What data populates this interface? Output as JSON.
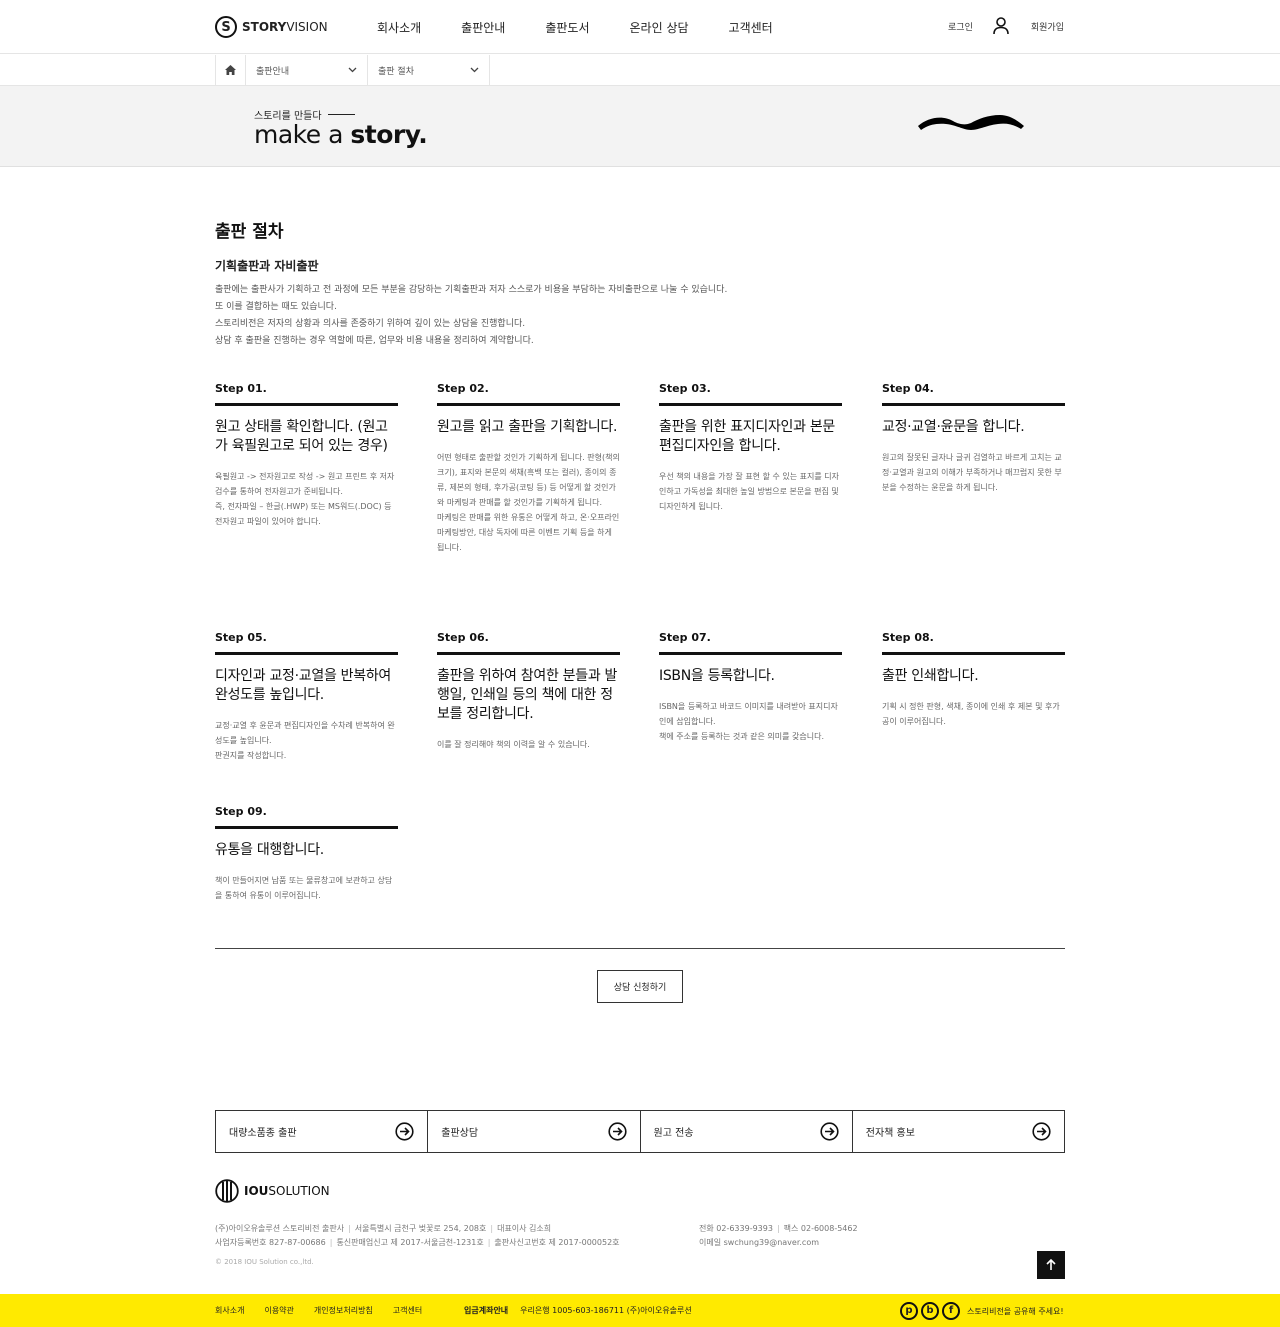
{
  "header": {
    "logo_mark": "S",
    "logo_bold": "STORY",
    "logo_light": "VISION",
    "nav": [
      "회사소개",
      "출판안내",
      "출판도서",
      "온라인 상담",
      "고객센터"
    ],
    "login": "로그인",
    "signup": "회원가입"
  },
  "breadcrumb": {
    "item1": "출판안내",
    "item2": "출판 절차"
  },
  "visual": {
    "subtitle": "스토리를 만들다",
    "title_light": "make a ",
    "title_bold": "story."
  },
  "content": {
    "page_title": "출판 절차",
    "section_title": "기획출판과 자비출판",
    "intro": [
      "출판에는 출판사가 기획하고 전 과정에 모든 부분을 감당하는 기획출판과 저자 스스로가 비용을 부담하는 자비출판으로 나눌 수 있습니다.",
      "또 이를 결합하는 때도 있습니다.",
      "스토리비전은 저자의 상황과 의사를 존중하기 위하여 깊이 있는 상담을 진행합니다.",
      "상담 후 출판을 진행하는 경우 역할에 따른, 업무와 비용 내용을 정리하여 계약합니다."
    ],
    "steps": [
      {
        "num": "Step 01.",
        "title": "원고 상태를 확인합니다. (원고가 육필원고로 되어 있는 경우)",
        "desc": "육필원고 -> 전자원고로 작성 -> 원고 프린트 후 저자 검수를 통하여 전자원고가 준비됩니다.\n즉, 전자파일 – 한글(.HWP) 또는 MS워드(.DOC) 등 전자원고 파일이 있어야 합니다."
      },
      {
        "num": "Step 02.",
        "title": "원고를 읽고 출판을 기획합니다.",
        "desc": "어떤 형태로 출판할 것인가 기획하게 됩니다. 판형(책의 크기), 표지와 본문의 색채(흑백 또는 컬러), 종이의 종류, 제본의 형태, 후가공(코팅 등) 등 어떻게 할 것인가와 마케팅과 판매를 할 것인가를 기획하게 됩니다.\n마케팅은 판매를 위한 유통은 어떻게 하고, 온·오프라인 마케팅방안, 대상 독자에 따른 이벤트 기획 등을 하게 됩니다."
      },
      {
        "num": "Step 03.",
        "title": "출판을 위한 표지디자인과 본문 편집디자인을 합니다.",
        "desc": "우선 책의 내용을 가장 잘 표현 할 수 있는 표지를 디자인하고 가독성을 최대한 높일 방법으로 본문을 편집 및 디자인하게 됩니다."
      },
      {
        "num": "Step 04.",
        "title": "교정·교열·윤문을 합니다.",
        "desc": "원고의 잘못된 글자나 글귀 검열하고 바르게 고치는 교정·교열과 원고의 이해가 부족하거나 매끄럽지 못한 부분을 수정하는 윤문을 하게 됩니다."
      },
      {
        "num": "Step 05.",
        "title": "디자인과 교정·교열을 반복하여 완성도를 높입니다.",
        "desc": "교정·교열 후 윤문과 편집디자인을 수차례 반복하여 완성도를 높입니다.\n판권지를 작성합니다."
      },
      {
        "num": "Step 06.",
        "title": "출판을 위하여 참여한 분들과 발행일, 인쇄일 등의 책에 대한 정보를 정리합니다.",
        "desc": "이를 잘 정리해야 책의 이력을 알 수 있습니다."
      },
      {
        "num": "Step 07.",
        "title": "ISBN을 등록합니다.",
        "desc": "ISBN을 등록하고 바코드 이미지를 내려받아 표지디자인에 삽입합니다.\n책에 주소를 등록하는 것과 같은 의미를 갖습니다."
      },
      {
        "num": "Step 08.",
        "title": "출판 인쇄합니다.",
        "desc": "기획 시 정한 판형, 색채, 종이에 인쇄 후 제본 및 후가공이 이루어집니다."
      },
      {
        "num": "Step 09.",
        "title": "유통을 대행합니다.",
        "desc": "책이 만들어지면 납품 또는 물류창고에 보관하고 상담을 통하여 유통이 이루어집니다."
      }
    ],
    "consult_button": "상담 신청하기"
  },
  "quick_links": [
    "대량소품종 출판",
    "출판상담",
    "원고 전송",
    "전자책 홍보"
  ],
  "footer": {
    "logo_bold": "IOU",
    "logo_light": "SOLUTION",
    "company": "(주)아이오유솔루션 스토리비전 출판사",
    "address": "서울특별시 금천구 벚꽃로 254, 208호",
    "ceo": "대표이사 김소희",
    "biz_no": "사업자등록번호 827-87-00686",
    "ecommerce_no": "통신판매업신고 제 2017-서울금천-1231호",
    "publisher_no": "출판사신고번호 제 2017-000052호",
    "phone": "전화 02-6339-9393",
    "fax": "팩스 02-6008-5462",
    "email": "이메일 swchung39@naver.com",
    "copyright": "© 2018 IOU Solution co.,ltd."
  },
  "bottom_bar": {
    "links": [
      "회사소개",
      "이용약관",
      "개인정보처리방침",
      "고객센터"
    ],
    "account_label": "입금계좌안내",
    "account_info": "우리은행 1005-603-186711 (주)아이오유솔루션",
    "sns": [
      "p",
      "b",
      "f"
    ],
    "share_text": "스토리비전을 공유해 주세요!"
  },
  "colors": {
    "accent_yellow": "#ffea00",
    "visual_bg": "#f3f3f3",
    "text_dark": "#111111"
  }
}
